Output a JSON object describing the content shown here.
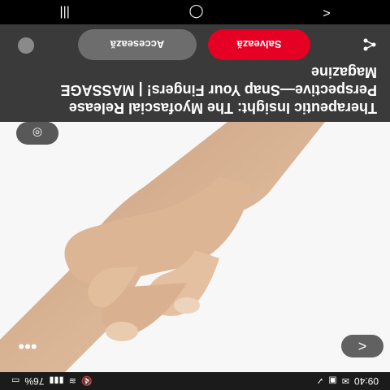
{
  "status": {
    "time": "09:40",
    "battery": "76%"
  },
  "header": {
    "title": "Therapeutic Insight: The Myofascial Release Perspective—Snap Your Fingers! | MASSAGE Magazine",
    "save_label": "Salvează",
    "access_label": "Accesează"
  },
  "icons": {
    "back": "<",
    "more": "•••",
    "lens": "◎",
    "share": "share-icon"
  },
  "nav": {
    "recents": "|||",
    "home": "◯",
    "back": "<"
  }
}
